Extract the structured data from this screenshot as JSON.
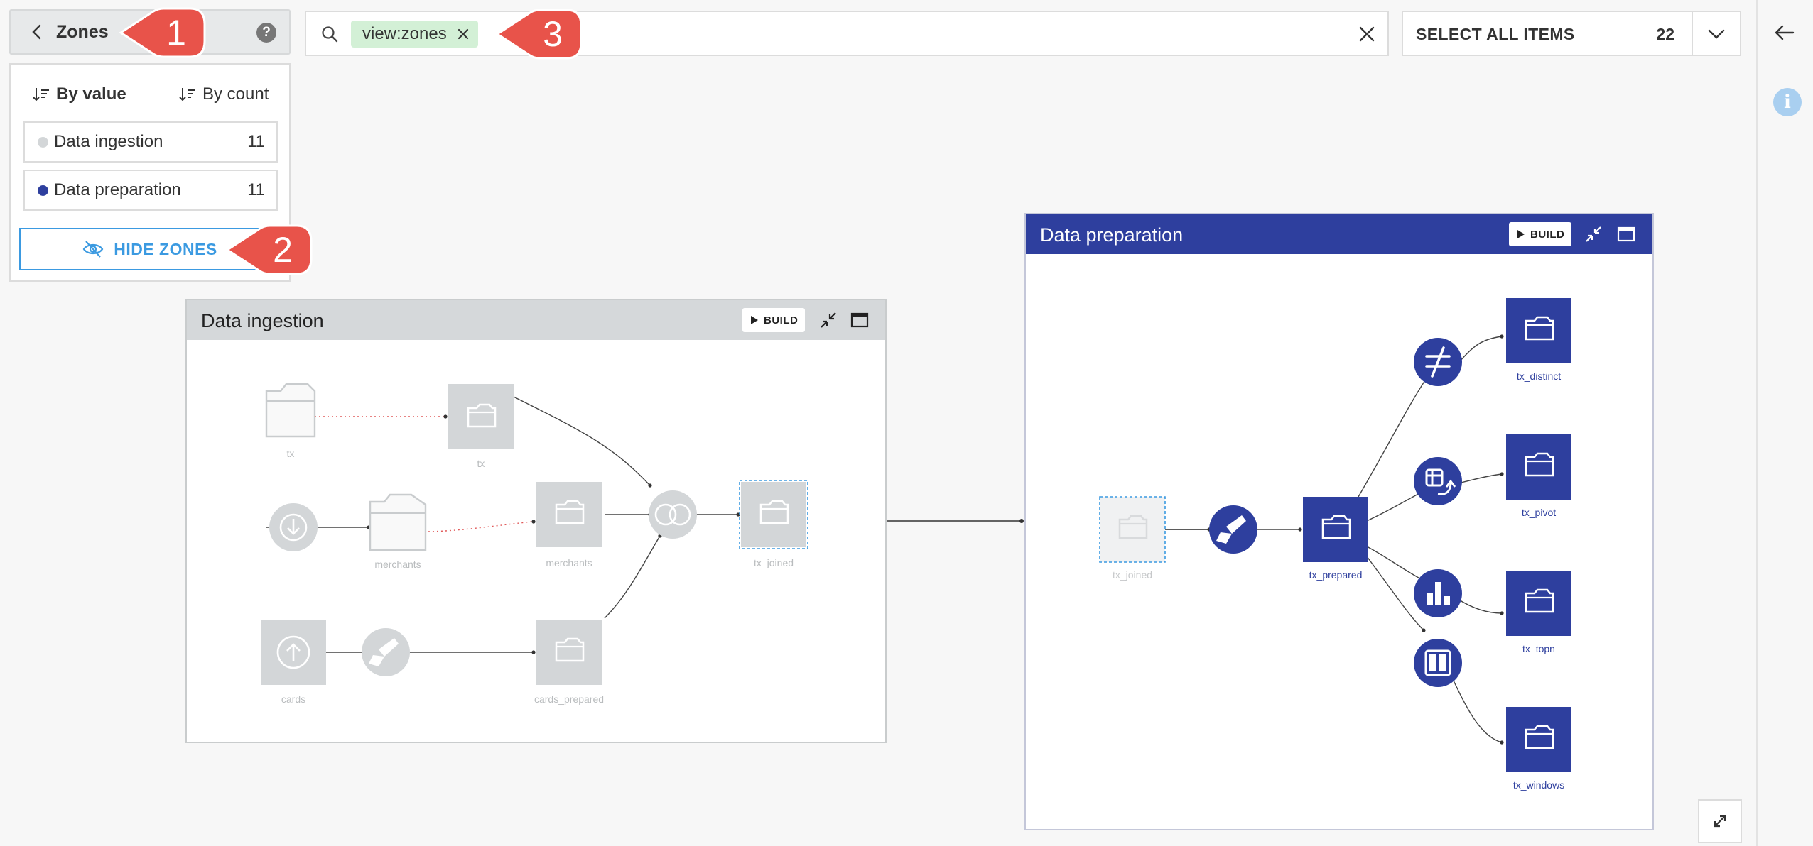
{
  "zones_panel": {
    "title": "Zones",
    "help_icon": "?",
    "sort_by_value": "By value",
    "sort_by_count": "By count",
    "items": [
      {
        "label": "Data ingestion",
        "count": "11",
        "color": "#d3d6d8"
      },
      {
        "label": "Data preparation",
        "count": "11",
        "color": "#2e3f9e"
      }
    ],
    "hide_button": "HIDE ZONES"
  },
  "search": {
    "chip_label": "view:zones"
  },
  "select_all": {
    "label": "SELECT ALL ITEMS",
    "count": "22"
  },
  "callouts": [
    "1",
    "2",
    "3"
  ],
  "zones": {
    "ingestion": {
      "title": "Data ingestion",
      "build_label": "BUILD",
      "header_color": "#d5d8da",
      "nodes": {
        "tx_folder": "tx",
        "tx_dataset": "tx",
        "merchants_folder": "merchants",
        "merchants_dataset": "merchants",
        "tx_joined": "tx_joined",
        "cards": "cards",
        "cards_prepared": "cards_prepared"
      }
    },
    "preparation": {
      "title": "Data preparation",
      "build_label": "BUILD",
      "header_color": "#2e3f9e",
      "nodes": {
        "tx_joined": "tx_joined",
        "tx_prepared": "tx_prepared",
        "tx_distinct": "tx_distinct",
        "tx_pivot": "tx_pivot",
        "tx_topn": "tx_topn",
        "tx_windows": "tx_windows"
      }
    }
  },
  "colors": {
    "accent_blue": "#3b9ae1",
    "zone_navy": "#2e3f9e",
    "callout_red": "#e8534a",
    "chip_green": "#d3f0d6",
    "faded_gray": "#d3d6d8"
  }
}
